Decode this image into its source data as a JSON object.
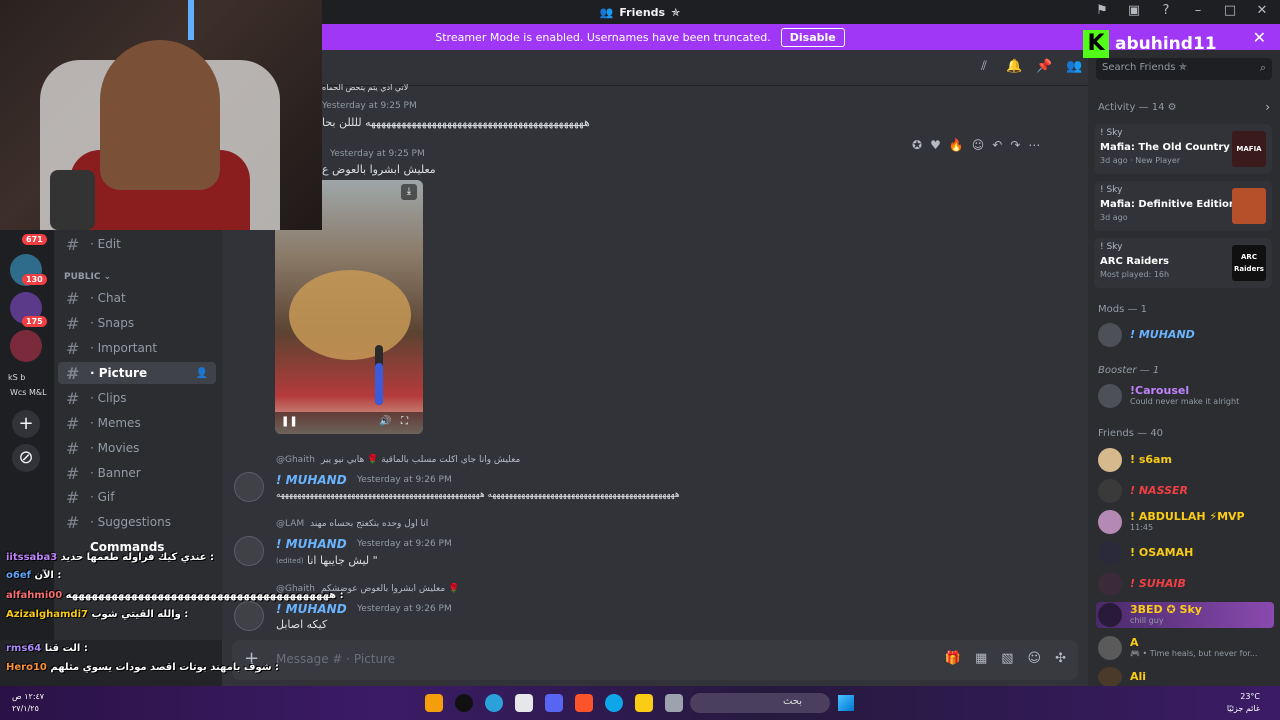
{
  "window": {
    "title": "Friends",
    "streamer_banner": "Streamer Mode is enabled. Usernames have been truncated.",
    "disable_label": "Disable"
  },
  "brand": {
    "letter": "K",
    "name": "abuhind11"
  },
  "rail": {
    "badges": [
      "671",
      "130",
      "175"
    ],
    "labels": [
      "kS b",
      "Wcs M&L"
    ]
  },
  "channels": {
    "edit": "· Edit",
    "category_public": "PUBLIC",
    "items": [
      "· Chat",
      "· Snaps",
      "· Important",
      "· Picture",
      "· Clips",
      "· Memes",
      "· Movies",
      "· Banner",
      "· Gif",
      "· Suggestions",
      "Commands"
    ],
    "active_index": 3
  },
  "overlay_chat": [
    {
      "user": "iitssaba3",
      "text": "عندي كيك فراوله طعمها حديد :",
      "color": "#c084fc"
    },
    {
      "user": "o6ef",
      "text": "الآن :",
      "color": "#60a5fa"
    },
    {
      "user": "alfahmi00",
      "text": "ههههههههههههههههههههههههههههههههههههههههه :",
      "color": "#f87171"
    },
    {
      "user": "Azizalghamdi7",
      "text": "والله القيتي شوب :",
      "color": "#facc15"
    },
    {
      "user": "rms64",
      "text": "الت قنا :",
      "color": "#a78bfa"
    },
    {
      "user": "Hero10",
      "text": "شوف بامهند بوتات اقصد مودات يسوي مثلهم :",
      "color": "#fb923c"
    }
  ],
  "messages": {
    "top_text_1": "لاتي ادي يتم يتحض الحماه",
    "top_ts_1": "Yesterday at 9:25 PM",
    "top_body_1": "هههههههههههههههههههههههههههههههههههههههههههه للللن بحا",
    "second_ts": "Yesterday at 9:25 PM",
    "second_body": "معليش ابشروا بالعوض ع",
    "msg3_reply_user": "@Ghaith",
    "msg3_reply_text": "معليش وانا جاي اكلت مسلب بالماقية 🌹 هابي نيو يير",
    "msg3_author": "! MUHAND",
    "msg3_ts": "Yesterday at 9:26 PM",
    "msg3_body": "هههههههههههههههههههههههههههههههههههههههههههههه هههههههههههههههههههههههههههههههههههههههههههههههههه",
    "msg4_reply_user": "@LAM",
    "msg4_reply_text": "انا اول وحده بتكعتج بحساه مهند",
    "msg4_author": "! MUHAND",
    "msg4_ts": "Yesterday at 9:26 PM",
    "msg4_body": "ليش جايبها انا \"",
    "msg4_edited": "(edited)",
    "msg5_reply_user": "@Ghaith",
    "msg5_reply_text": "معليش ابشروا بالعوض عوضشكم 🌹",
    "msg5_author": "! MUHAND",
    "msg5_ts": "Yesterday at 9:26 PM",
    "msg5_body": "كيكه اصابل"
  },
  "input": {
    "placeholder": "Message # · Picture"
  },
  "right_panel": {
    "search_placeholder": "Search Friends ✯",
    "activity_header": "Activity — 14",
    "activities": [
      {
        "user": "! Sky",
        "game": "Mafia: The Old Country",
        "meta": "3d ago · New Player",
        "art": "MAFIA",
        "art_color": "#3a1a1a"
      },
      {
        "user": "! Sky",
        "game": "Mafia: Definitive Edition",
        "meta": "3d ago",
        "art": "",
        "art_color": "#b6502a"
      },
      {
        "user": "! Sky",
        "game": "ARC Raiders",
        "meta": "Most played: 16h",
        "art": "ARC Raiders",
        "art_color": "#101010"
      }
    ],
    "mods_header": "Mods — 1",
    "mods": [
      {
        "name": "! MUHAND",
        "color": "#6ab3ff"
      }
    ],
    "booster_header": "Booster — 1",
    "boosters": [
      {
        "name": "!Carousel",
        "status": "Could never make it alright",
        "color": "#c084fc"
      }
    ],
    "friends_header": "Friends — 40",
    "friends": [
      {
        "name": "! s6am",
        "status": "",
        "color": "#facc15"
      },
      {
        "name": "! NASSER",
        "status": "",
        "color": "#f23f43"
      },
      {
        "name": "! ABDULLAH ⚡MVP",
        "status": "11:45",
        "color": "#facc15"
      },
      {
        "name": "! OSAMAH",
        "status": "",
        "color": "#facc15"
      },
      {
        "name": "! SUHAIB",
        "status": "",
        "color": "#f23f43"
      },
      {
        "name": "3BED ✪ Sky",
        "status": "chill guy",
        "color": "#facc15"
      },
      {
        "name": "A",
        "status": "🎮 • Time heals, but never for...",
        "color": "#facc15"
      },
      {
        "name": "Ali",
        "status": "",
        "color": "#facc15"
      }
    ]
  },
  "taskbar": {
    "search": "بحث",
    "clock_time": "١٢:٤٧ ص",
    "clock_date": "٢٧/١/٢٥",
    "weather_temp": "23°C",
    "weather_text": "غائم جزئيًا"
  }
}
